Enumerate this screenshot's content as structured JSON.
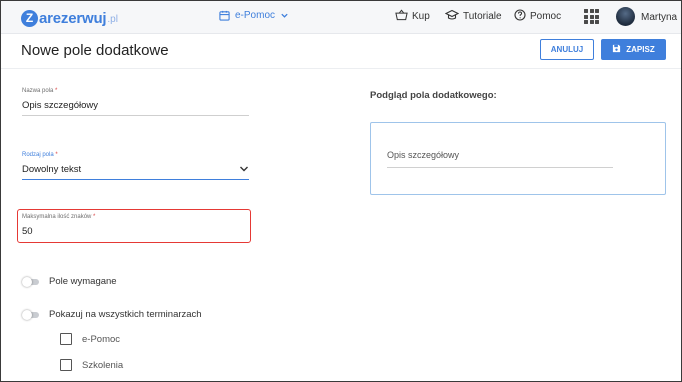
{
  "topbar": {
    "logo_letter": "Z",
    "logo_text": "arezerwuj",
    "logo_tld": ".pl",
    "center_menu_label": "e-Pomoc",
    "nav": {
      "shop_label": "Kup",
      "tutorials_label": "Tutoriale",
      "help_label": "Pomoc"
    },
    "user_name": "Martyna"
  },
  "header": {
    "title": "Nowe pole dodatkowe",
    "cancel_label": "ANULUJ",
    "save_label": "ZAPISZ"
  },
  "form": {
    "field_name": {
      "label": "Nazwa pola",
      "required_mark": "*",
      "value": "Opis szczegółowy"
    },
    "field_type": {
      "label": "Rodzaj pola",
      "required_mark": "*",
      "value": "Dowolny tekst"
    },
    "max_chars": {
      "label": "Maksymalna ilość znaków",
      "required_mark": "*",
      "value": "50"
    },
    "toggles": [
      {
        "label": "Pole wymagane",
        "on": false
      },
      {
        "label": "Pokazuj na wszystkich terminarzach",
        "on": false
      }
    ],
    "checkboxes": [
      {
        "label": "e-Pomoc",
        "checked": false
      },
      {
        "label": "Szkolenia",
        "checked": false
      }
    ]
  },
  "preview": {
    "title": "Podgląd pola dodatkowego:",
    "field_label": "Opis szczegółowy"
  },
  "colors": {
    "accent": "#3f7fdc",
    "required": "#d94040",
    "highlight": "#e53935"
  }
}
